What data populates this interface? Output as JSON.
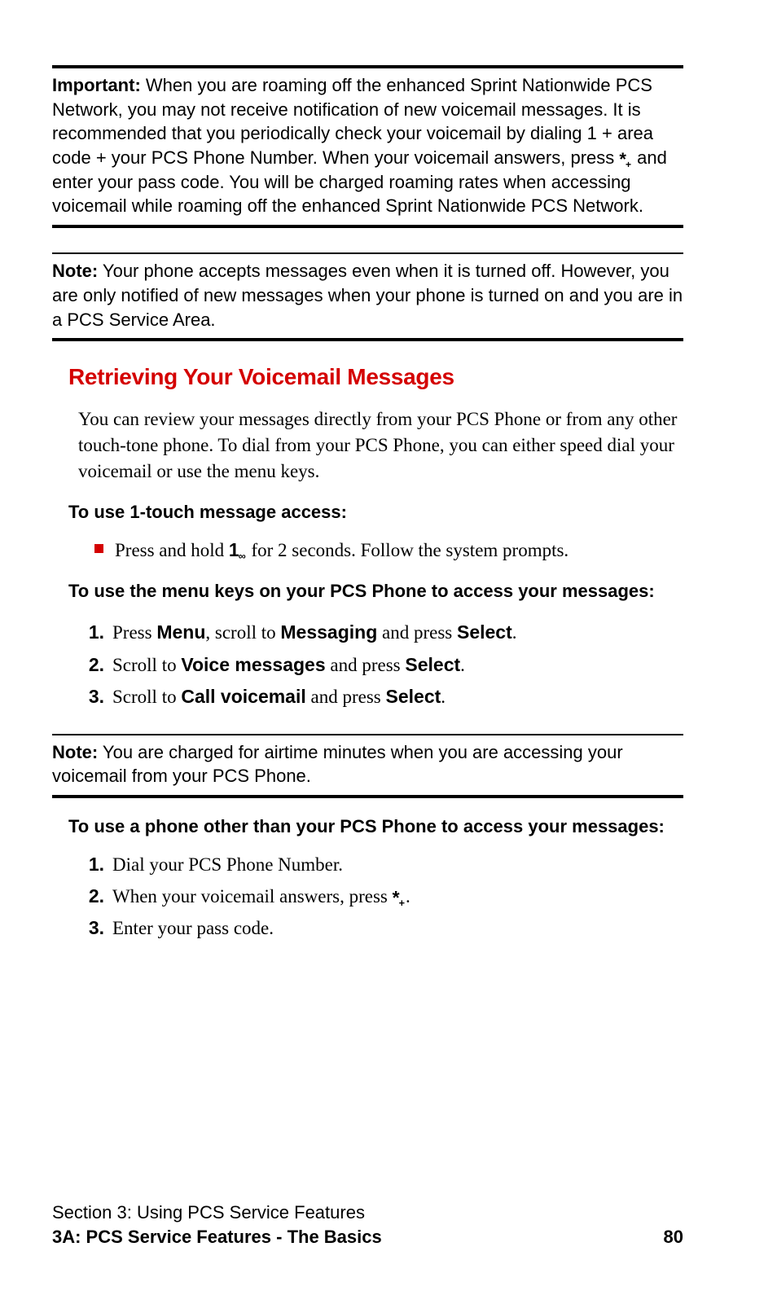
{
  "important": {
    "lead": "Important:",
    "text_a": " When you are roaming off the enhanced Sprint Nationwide PCS Network, you may not receive notification of new voicemail messages. It is recommended that you periodically check your voicemail by dialing 1 + area code + your PCS Phone Number. When your voicemail answers, press ",
    "star": "*",
    "text_b": " and enter your pass code. You will be charged roaming rates when accessing voicemail while roaming off the enhanced Sprint Nationwide PCS Network."
  },
  "note1": {
    "lead": "Note:",
    "text": " Your phone accepts messages even when it is turned off. However, you are only notified of new messages when your phone is turned on and you are in a PCS Service Area."
  },
  "heading": "Retrieving Your Voicemail Messages",
  "intro": "You can review your messages directly from your PCS Phone or from any other touch-tone phone. To dial from your PCS Phone, you can either speed dial your voicemail or use the menu keys.",
  "sub1": "To use 1-touch message access:",
  "bullet": {
    "a": "Press and hold ",
    "b": " for 2 seconds. Follow the system prompts."
  },
  "sub2": "To use the menu keys on your PCS Phone to access your messages:",
  "steps1": {
    "n1": "1.",
    "t1a": "Press ",
    "t1b": "Menu",
    "t1c": ", scroll to ",
    "t1d": "Messaging",
    "t1e": " and press ",
    "t1f": "Select",
    "t1g": ".",
    "n2": "2.",
    "t2a": "Scroll to ",
    "t2b": "Voice messages",
    "t2c": " and press ",
    "t2d": "Select",
    "t2e": ".",
    "n3": "3.",
    "t3a": "Scroll to ",
    "t3b": "Call voicemail",
    "t3c": " and press ",
    "t3d": "Select",
    "t3e": "."
  },
  "note2": {
    "lead": "Note:",
    "text": " You are charged for airtime minutes when you are accessing your voicemail from your PCS Phone."
  },
  "sub3": "To use a phone other than your PCS Phone to access your messages:",
  "steps2": {
    "n1": "1.",
    "t1": "Dial your PCS Phone Number.",
    "n2": "2.",
    "t2a": "When your voicemail answers, press ",
    "star": "*",
    "t2b": ".",
    "n3": "3.",
    "t3": "Enter your pass code."
  },
  "footer": {
    "line1": "Section 3: Using PCS Service Features",
    "line2": "3A: PCS Service Features - The Basics",
    "page": "80"
  }
}
